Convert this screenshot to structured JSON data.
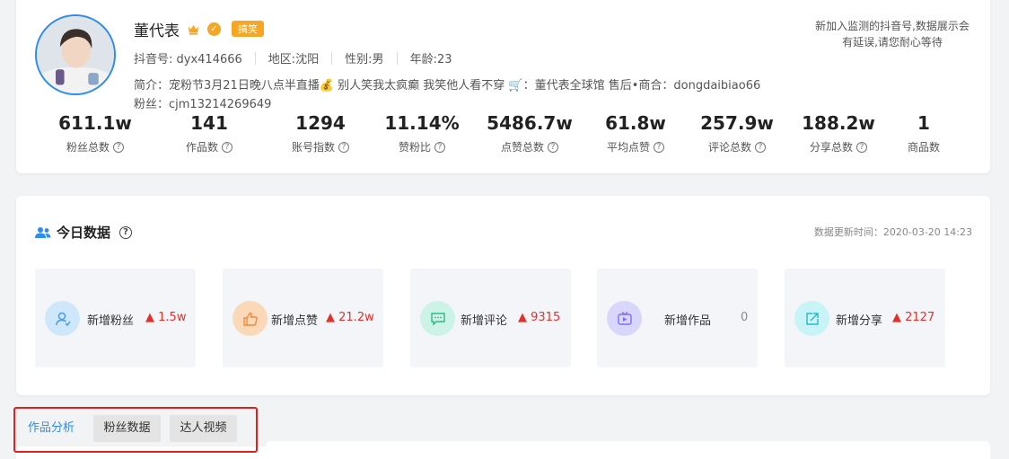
{
  "profile": {
    "name": "董代表",
    "tag": "搞笑",
    "meta": {
      "douyin_id": "抖音号: dyx414666",
      "region": "地区:沈阳",
      "gender": "性别:男",
      "age": "年龄:23"
    },
    "intro": "简介：宠粉节3月21日晚八点半直播💰 别人笑我太疯癫 我笑他人看不穿 🛒：董代表全球馆 售后•商合：dongdaibiao66",
    "fans_line": "粉丝：cjm13214269649",
    "notice": "新加入监测的抖音号,数据展示会有延误,请您耐心等待",
    "stats": [
      {
        "value": "611.1w",
        "label": "粉丝总数",
        "help": true
      },
      {
        "value": "141",
        "label": "作品数",
        "help": true
      },
      {
        "value": "1294",
        "label": "账号指数",
        "help": true
      },
      {
        "value": "11.14%",
        "label": "赞粉比",
        "help": true
      },
      {
        "value": "5486.7w",
        "label": "点赞总数",
        "help": true
      },
      {
        "value": "61.8w",
        "label": "平均点赞",
        "help": true
      },
      {
        "value": "257.9w",
        "label": "评论总数",
        "help": true
      },
      {
        "value": "188.2w",
        "label": "分享总数",
        "help": true
      },
      {
        "value": "1",
        "label": "商品数",
        "help": false
      }
    ]
  },
  "today": {
    "title": "今日数据",
    "update_time": "数据更新时间：2020-03-20 14:23",
    "metrics": [
      {
        "label": "新增粉丝",
        "value": "1.5w",
        "trend": "up",
        "icon": "user-icon",
        "color": "#cfe7fb",
        "fg": "#4a9be8"
      },
      {
        "label": "新增点赞",
        "value": "21.2w",
        "trend": "up",
        "icon": "thumbs-up-icon",
        "color": "#fbd9b8",
        "fg": "#f08a3a"
      },
      {
        "label": "新增评论",
        "value": "9315",
        "trend": "up",
        "icon": "comment-icon",
        "color": "#cdf2e6",
        "fg": "#2dbb8a"
      },
      {
        "label": "新增作品",
        "value": "0",
        "trend": "none",
        "icon": "video-icon",
        "color": "#d9d6fb",
        "fg": "#7f6ef0"
      },
      {
        "label": "新增分享",
        "value": "2127",
        "trend": "up",
        "icon": "share-icon",
        "color": "#c8f3f7",
        "fg": "#25b9cc"
      }
    ]
  },
  "tabs": [
    {
      "label": "作品分析",
      "active": true
    },
    {
      "label": "粉丝数据",
      "active": false
    },
    {
      "label": "达人视频",
      "active": false
    }
  ],
  "up_arrow": "▲"
}
